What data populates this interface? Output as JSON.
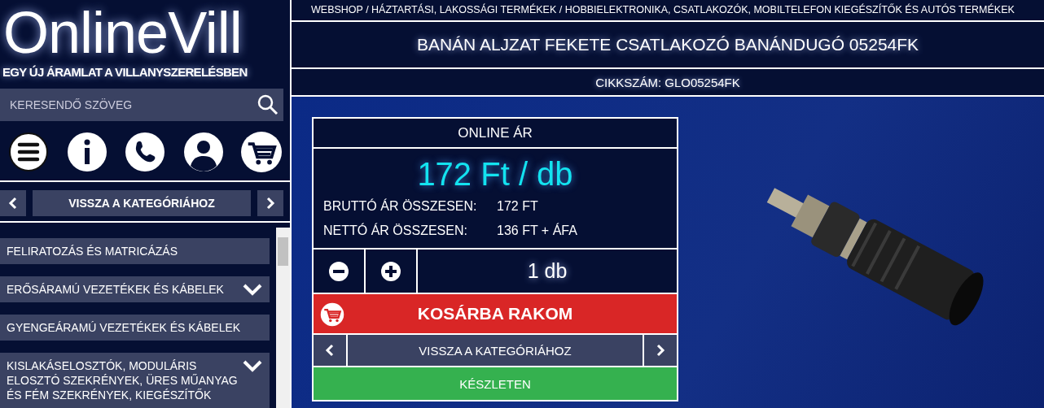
{
  "logo": {
    "title": "OnlineVill",
    "tagline": "EGY ÚJ ÁRAMLAT A VILLANYSZERELÉSBEN"
  },
  "search": {
    "placeholder": "KERESENDŐ SZÖVEG"
  },
  "category_nav": {
    "label": "VISSZA A KATEGÓRIÁHOZ"
  },
  "categories": [
    {
      "label": "FELIRATOZÁS ÉS MATRICÁZÁS",
      "has_children": false
    },
    {
      "label": "ERŐSÁRAMÚ VEZETÉKEK ÉS KÁBELEK",
      "has_children": true
    },
    {
      "label": "GYENGEÁRAMÚ VEZETÉKEK ÉS KÁBELEK",
      "has_children": false
    },
    {
      "label": "KISLAKÁSELOSZTÓK, MODULÁRIS ELOSZTÓ SZEKRÉNYEK, ÜRES MŰANYAG ÉS FÉM SZEKRÉNYEK, KIEGÉSZÍTŐK",
      "has_children": true
    }
  ],
  "breadcrumb": "WEBSHOP / HÁZTARTÁSI, LAKOSSÁGI TERMÉKEK / HOBBIELEKTRONIKA, CSATLAKOZÓK, MOBILTELEFON KIEGÉSZÍTŐK ÉS AUTÓS TERMÉKEK",
  "product": {
    "title": "BANÁN ALJZAT FEKETE CSATLAKOZÓ BANÁNDUGÓ 05254FK",
    "sku": "CIKKSZÁM: GLO05254FK"
  },
  "price_box": {
    "heading": "ONLINE ÁR",
    "unit_price": "172 Ft / db",
    "rows": [
      {
        "label": "BRUTTÓ ÁR ÖSSZESEN:",
        "value": "172 FT"
      },
      {
        "label": "NETTÓ ÁR ÖSSZESEN:",
        "value": "136 FT + ÁFA"
      }
    ],
    "quantity": "1 db",
    "add_to_cart": "KOSÁRBA RAKOM",
    "back_label": "VISSZA A KATEGÓRIÁHOZ",
    "stock": "KÉSZLETEN"
  }
}
